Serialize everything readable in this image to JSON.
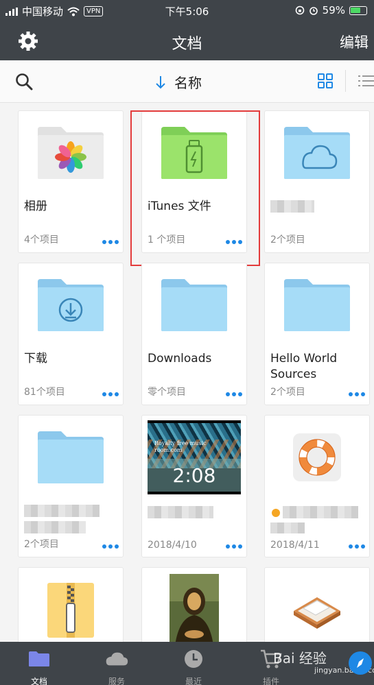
{
  "status_bar": {
    "carrier": "中国移动",
    "vpn": "VPN",
    "time": "下午5:06",
    "battery": "59%"
  },
  "nav": {
    "title": "文档",
    "edit_label": "编辑"
  },
  "toolbar": {
    "sort_label": "名称",
    "accent": "#1e88e5"
  },
  "files": [
    {
      "name": "相册",
      "meta": "4个项目",
      "icon": "photos-folder-icon"
    },
    {
      "name": "iTunes 文件",
      "meta": "1 个项目",
      "icon": "usb-folder-icon"
    },
    {
      "name": "",
      "meta": "2个项目",
      "icon": "cloud-folder-icon"
    },
    {
      "name": "下载",
      "meta": "81个项目",
      "icon": "download-folder-icon"
    },
    {
      "name": "Downloads",
      "meta": "零个项目",
      "icon": "folder-icon"
    },
    {
      "name": "Hello World Sources",
      "meta": "2个项目",
      "icon": "folder-icon"
    },
    {
      "name": "",
      "meta": "2个项目",
      "icon": "folder-icon"
    },
    {
      "name": "",
      "meta": "2018/4/10",
      "icon": "video-thumbnail",
      "duration": "2:08",
      "video_caption": "Royalty free music room.com"
    },
    {
      "name": "",
      "meta": "2018/4/11",
      "icon": "lifebuoy-icon"
    },
    {
      "name": "",
      "meta": "",
      "icon": "zip-archive-icon"
    },
    {
      "name": "",
      "meta": "",
      "icon": "mona-lisa-image"
    },
    {
      "name": "",
      "meta": "",
      "icon": "inbox-tray-icon"
    }
  ],
  "tabs": [
    {
      "label": "文档",
      "icon": "folder-icon",
      "active": true
    },
    {
      "label": "服务",
      "icon": "cloud-icon",
      "active": false
    },
    {
      "label": "最近",
      "icon": "clock-icon",
      "active": false
    },
    {
      "label": "插件",
      "icon": "cart-icon",
      "active": false
    }
  ],
  "watermark": {
    "text": "Bai 经验",
    "url_text": "jingyan.baidu.com"
  }
}
